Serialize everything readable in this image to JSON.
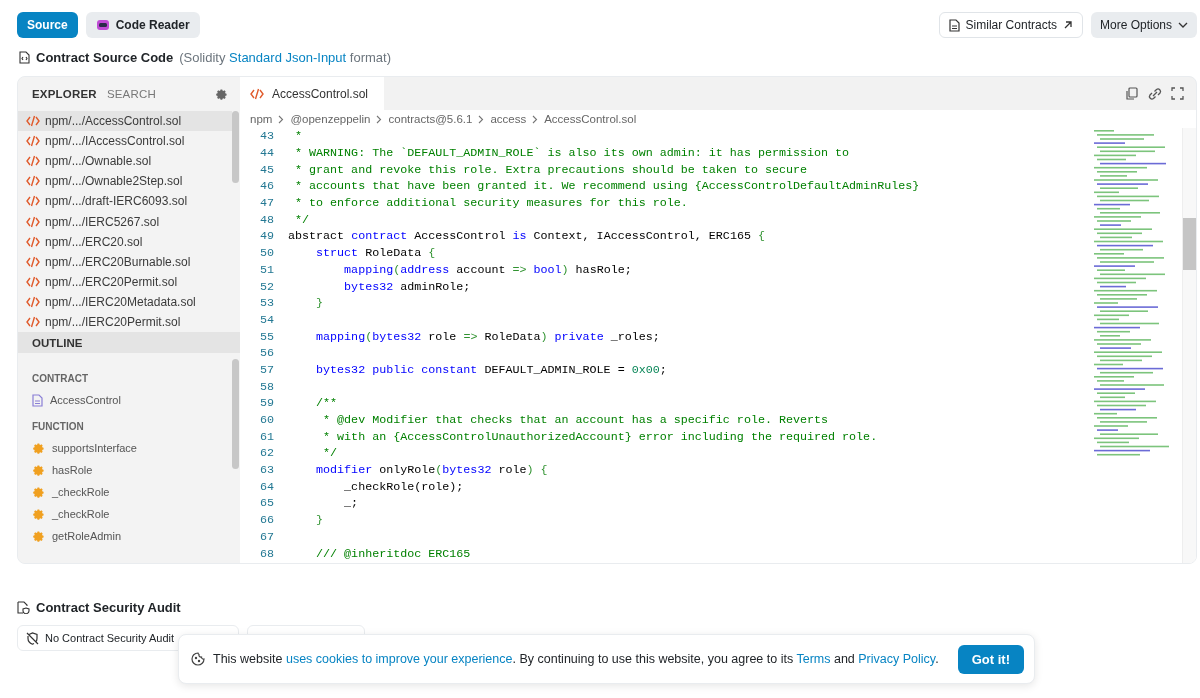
{
  "top_buttons": [
    {
      "label": "Source",
      "selected": true
    },
    {
      "label": "Code Reader",
      "selected": false
    }
  ],
  "right_buttons": [
    {
      "label": "Similar Contracts",
      "kind": "external"
    },
    {
      "label": "More Options",
      "kind": "dropdown"
    }
  ],
  "section_title": {
    "title": "Contract Source Code",
    "note_before": "(Solidity ",
    "note_link": "Standard Json-Input",
    "note_after": " format)"
  },
  "sidebar": {
    "tabs": [
      {
        "label": "EXPLORER",
        "selected": true
      },
      {
        "label": "SEARCH",
        "selected": false
      }
    ],
    "files": [
      {
        "name": "npm/.../AccessControl.sol",
        "selected": true
      },
      {
        "name": "npm/.../IAccessControl.sol",
        "selected": false
      },
      {
        "name": "npm/.../Ownable.sol",
        "selected": false
      },
      {
        "name": "npm/.../Ownable2Step.sol",
        "selected": false
      },
      {
        "name": "npm/.../draft-IERC6093.sol",
        "selected": false
      },
      {
        "name": "npm/.../IERC5267.sol",
        "selected": false
      },
      {
        "name": "npm/.../ERC20.sol",
        "selected": false
      },
      {
        "name": "npm/.../ERC20Burnable.sol",
        "selected": false
      },
      {
        "name": "npm/.../ERC20Permit.sol",
        "selected": false
      },
      {
        "name": "npm/.../IERC20Metadata.sol",
        "selected": false
      },
      {
        "name": "npm/.../IERC20Permit.sol",
        "selected": false
      }
    ],
    "outline_title": "OUTLINE",
    "outline": [
      {
        "heading": "CONTRACT",
        "kind": "contract",
        "items": [
          "AccessControl"
        ]
      },
      {
        "heading": "FUNCTION",
        "kind": "function",
        "items": [
          "supportsInterface",
          "hasRole",
          "_checkRole",
          "_checkRole",
          "getRoleAdmin"
        ]
      }
    ]
  },
  "editor": {
    "tab": "AccessControl.sol",
    "breadcrumb": [
      "npm",
      "@openzeppelin",
      "contracts@5.6.1",
      "access",
      "AccessControl.sol"
    ],
    "lines": [
      {
        "n": "43",
        "tokens": [
          {
            "t": " *",
            "kind": "comment"
          }
        ]
      },
      {
        "n": "44",
        "tokens": [
          {
            "t": " * WARNING: The `DEFAULT_ADMIN_ROLE` is also its own admin: it has permission to",
            "kind": "comment"
          }
        ]
      },
      {
        "n": "45",
        "tokens": [
          {
            "t": " * grant and revoke this role. Extra precautions should be taken to secure",
            "kind": "comment"
          }
        ]
      },
      {
        "n": "46",
        "tokens": [
          {
            "t": " * accounts that have been granted it. We recommend using {AccessControlDefaultAdminRules}",
            "kind": "comment"
          }
        ]
      },
      {
        "n": "47",
        "tokens": [
          {
            "t": " * to enforce additional security measures for this role.",
            "kind": "comment"
          }
        ]
      },
      {
        "n": "48",
        "tokens": [
          {
            "t": " */",
            "kind": "comment"
          }
        ]
      },
      {
        "n": "49",
        "tokens": [
          {
            "t": "abstract ",
            "kind": "plain"
          },
          {
            "t": "contract",
            "kind": "keyword"
          },
          {
            "t": " AccessControl ",
            "kind": "plain"
          },
          {
            "t": "is",
            "kind": "keyword"
          },
          {
            "t": " Context, IAccessControl, ERC165 ",
            "kind": "plain"
          },
          {
            "t": "{",
            "kind": "punct"
          }
        ]
      },
      {
        "n": "50",
        "tokens": [
          {
            "t": "    struct",
            "kind": "keyword"
          },
          {
            "t": " RoleData ",
            "kind": "plain"
          },
          {
            "t": "{",
            "kind": "punct"
          }
        ]
      },
      {
        "n": "51",
        "tokens": [
          {
            "t": "        mapping",
            "kind": "keyword"
          },
          {
            "t": "(",
            "kind": "punct"
          },
          {
            "t": "address",
            "kind": "keyword"
          },
          {
            "t": " account ",
            "kind": "plain"
          },
          {
            "t": "=> ",
            "kind": "punct"
          },
          {
            "t": "bool",
            "kind": "keyword"
          },
          {
            "t": ")",
            "kind": "punct"
          },
          {
            "t": " hasRole;",
            "kind": "plain"
          }
        ]
      },
      {
        "n": "52",
        "tokens": [
          {
            "t": "        bytes32",
            "kind": "keyword"
          },
          {
            "t": " adminRole;",
            "kind": "plain"
          }
        ]
      },
      {
        "n": "53",
        "tokens": [
          {
            "t": "    }",
            "kind": "punct"
          }
        ]
      },
      {
        "n": "54"
      },
      {
        "n": "55",
        "tokens": [
          {
            "t": "    mapping",
            "kind": "keyword"
          },
          {
            "t": "(",
            "kind": "punct"
          },
          {
            "t": "bytes32",
            "kind": "keyword"
          },
          {
            "t": " role ",
            "kind": "plain"
          },
          {
            "t": "=>",
            "kind": "punct"
          },
          {
            "t": " RoleData",
            "kind": "plain"
          },
          {
            "t": ") ",
            "kind": "punct"
          },
          {
            "t": "private",
            "kind": "keyword"
          },
          {
            "t": " _roles;",
            "kind": "plain"
          }
        ]
      },
      {
        "n": "56"
      },
      {
        "n": "57",
        "tokens": [
          {
            "t": "    bytes32 public constant",
            "kind": "keyword"
          },
          {
            "t": " DEFAULT_ADMIN_ROLE = ",
            "kind": "plain"
          },
          {
            "t": "0x00",
            "kind": "number"
          },
          {
            "t": ";",
            "kind": "plain"
          }
        ]
      },
      {
        "n": "58"
      },
      {
        "n": "59",
        "tokens": [
          {
            "t": "    /**",
            "kind": "comment"
          }
        ]
      },
      {
        "n": "60",
        "tokens": [
          {
            "t": "     * @dev Modifier that checks that an account has a specific role. Reverts",
            "kind": "comment"
          }
        ]
      },
      {
        "n": "61",
        "tokens": [
          {
            "t": "     * with an {AccessControlUnauthorizedAccount} error including the required role.",
            "kind": "comment"
          }
        ]
      },
      {
        "n": "62",
        "tokens": [
          {
            "t": "     */",
            "kind": "comment"
          }
        ]
      },
      {
        "n": "63",
        "tokens": [
          {
            "t": "    modifier",
            "kind": "keyword"
          },
          {
            "t": " onlyRole",
            "kind": "plain"
          },
          {
            "t": "(",
            "kind": "punct"
          },
          {
            "t": "bytes32",
            "kind": "keyword"
          },
          {
            "t": " role",
            "kind": "plain"
          },
          {
            "t": ") {",
            "kind": "punct"
          }
        ]
      },
      {
        "n": "64",
        "tokens": [
          {
            "t": "        _checkRole(role);",
            "kind": "plain"
          }
        ]
      },
      {
        "n": "65",
        "tokens": [
          {
            "t": "        _;",
            "kind": "plain"
          }
        ]
      },
      {
        "n": "66",
        "tokens": [
          {
            "t": "    }",
            "kind": "punct"
          }
        ]
      },
      {
        "n": "67"
      },
      {
        "n": "68",
        "tokens": [
          {
            "t": "    /// @inheritdoc ERC165",
            "kind": "comment"
          }
        ]
      }
    ]
  },
  "audit": {
    "title": "Contract Security Audit",
    "button": "No Contract Security Audit"
  },
  "cookie": {
    "parts": [
      {
        "kind": "text",
        "t": "This website "
      },
      {
        "kind": "link",
        "t": "uses cookies to improve your experience"
      },
      {
        "kind": "text",
        "t": ". By continuing to use this website, you agree to its "
      },
      {
        "kind": "link",
        "t": "Terms"
      },
      {
        "kind": "text",
        "t": " and "
      },
      {
        "kind": "link",
        "t": "Privacy Policy"
      },
      {
        "kind": "text",
        "t": "."
      }
    ],
    "button": "Got it!"
  }
}
